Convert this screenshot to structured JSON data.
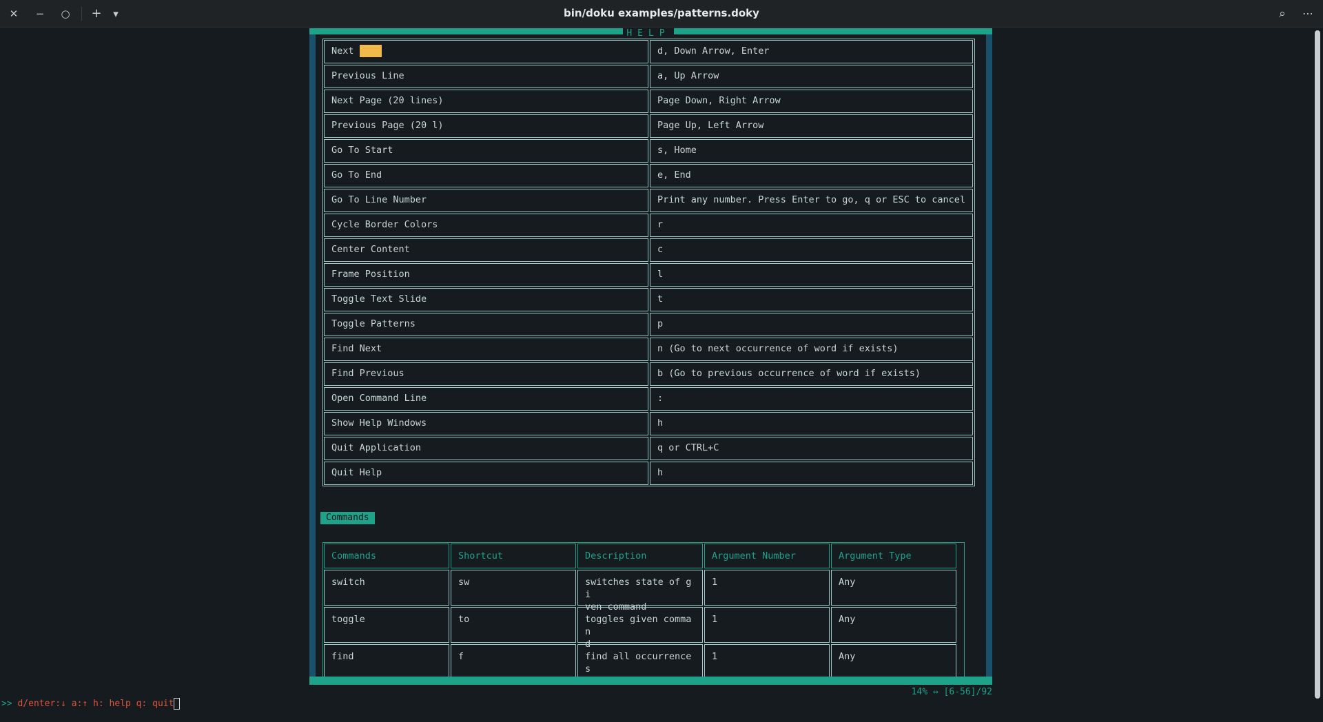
{
  "window": {
    "title": "bin/doku examples/patterns.doky",
    "close_glyph": "✕",
    "minimize_glyph": "−",
    "restore_glyph": "○",
    "new_tab_glyph": "+",
    "dropdown_glyph": "▾",
    "search_glyph": "⌕",
    "menu_glyph": "⋯"
  },
  "frame": {
    "title": "HELP",
    "border_color": "#1fa28a"
  },
  "help_table": {
    "rows": [
      {
        "action": "Next",
        "keys": "d, Down Arrow, Enter"
      },
      {
        "action": "Previous Line",
        "keys": "a, Up Arrow"
      },
      {
        "action": "Next Page (20 lines)",
        "keys": "Page Down, Right Arrow"
      },
      {
        "action": "Previous Page (20 l)",
        "keys": "Page Up, Left Arrow"
      },
      {
        "action": "Go To Start",
        "keys": "s, Home"
      },
      {
        "action": "Go To End",
        "keys": "e, End"
      },
      {
        "action": "Go To Line Number",
        "keys": "Print any number. Press Enter to go, q or ESC to cancel"
      },
      {
        "action": "Cycle Border Colors",
        "keys": "r"
      },
      {
        "action": "Center Content",
        "keys": "c"
      },
      {
        "action": "Frame Position",
        "keys": "l"
      },
      {
        "action": "Toggle Text Slide",
        "keys": "t"
      },
      {
        "action": "Toggle Patterns",
        "keys": "p"
      },
      {
        "action": "Find Next",
        "keys": "n (Go to next occurrence of word if exists)"
      },
      {
        "action": "Find Previous",
        "keys": "b (Go to previous occurrence of word if exists)"
      },
      {
        "action": "Open Command Line",
        "keys": ":"
      },
      {
        "action": "Show Help Windows",
        "keys": "h"
      },
      {
        "action": "Quit Application",
        "keys": "q or CTRL+C"
      },
      {
        "action": "Quit Help",
        "keys": "h"
      }
    ]
  },
  "commands_section": {
    "heading": "Commands",
    "headers": [
      "Commands",
      "Shortcut",
      "Description",
      "Argument Number",
      "Argument Type"
    ],
    "rows": [
      [
        "switch",
        "sw",
        "switches state of gi\nven command",
        "1",
        "Any"
      ],
      [
        "toggle",
        "to",
        "toggles given comman\nd",
        "1",
        "Any"
      ],
      [
        "find",
        "f",
        "find all occurrences\n of given text",
        "1",
        "Any"
      ]
    ]
  },
  "status": {
    "position": "14% ↔ [6-56]/92",
    "prompt_arrow": ">>",
    "prompt_text": " d/enter:↓ a:↑ h: help q: quit"
  }
}
